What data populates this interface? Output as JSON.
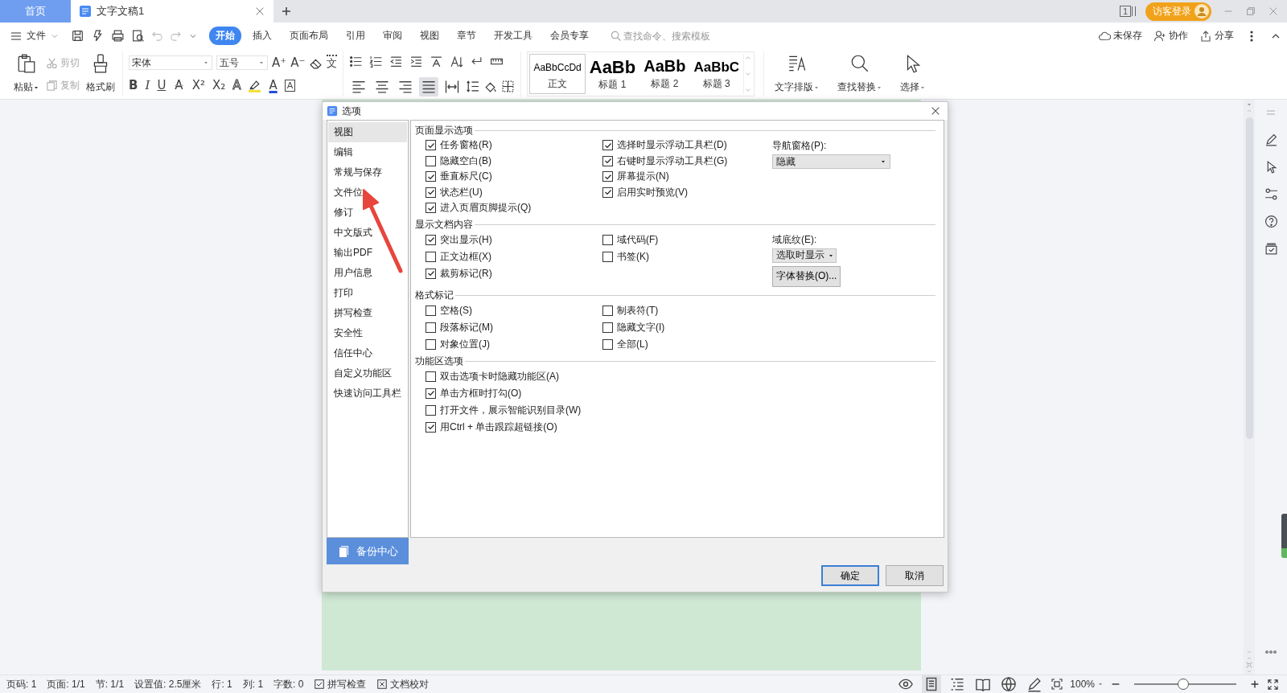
{
  "tabs": [
    {
      "label": "首页",
      "kind": "home",
      "selected": false
    },
    {
      "label": "文字文稿1",
      "kind": "doc",
      "selected": true
    }
  ],
  "title_bar": {
    "window_count": "1",
    "login": "访客登录"
  },
  "menu": {
    "file": "文件",
    "undo": {
      "disabled": true
    },
    "redo": {
      "disabled": true
    },
    "tabs": [
      {
        "label": "开始",
        "selected": true
      },
      {
        "label": "插入",
        "selected": false
      },
      {
        "label": "页面布局",
        "selected": false
      },
      {
        "label": "引用",
        "selected": false
      },
      {
        "label": "审阅",
        "selected": false
      },
      {
        "label": "视图",
        "selected": false
      },
      {
        "label": "章节",
        "selected": false
      },
      {
        "label": "开发工具",
        "selected": false
      },
      {
        "label": "会员专享",
        "selected": false
      }
    ],
    "search": {
      "placeholder": "查找命令、搜索模板"
    },
    "actions": [
      {
        "label": "未保存",
        "kind": "cloud"
      },
      {
        "label": "协作",
        "kind": "collab"
      },
      {
        "label": "分享",
        "kind": "share"
      }
    ]
  },
  "ribbon": {
    "paste": "粘贴",
    "clipboard": [
      {
        "label": "剪切",
        "kind": "cut",
        "disabled": true
      },
      {
        "label": "复制",
        "kind": "copy",
        "disabled": true
      }
    ],
    "format_painter": "格式刷",
    "font": {
      "name": "宋体",
      "size": "五号"
    },
    "font_row1": [
      {
        "glyph": "A⁺",
        "kind": "plain"
      },
      {
        "glyph": "A⁻",
        "kind": "plain"
      },
      {
        "kind": "eraser"
      },
      {
        "glyph": "文",
        "kind": "pinyin"
      }
    ],
    "font_row2": [
      {
        "glyph": "B",
        "kind": "bold"
      },
      {
        "glyph": "I",
        "kind": "italic"
      },
      {
        "glyph": "U",
        "kind": "underline"
      },
      {
        "glyph": "A",
        "kind": "strike"
      },
      {
        "glyph": "X²",
        "kind": "plain"
      },
      {
        "glyph": "X₂",
        "kind": "plain"
      },
      {
        "glyph": "A",
        "kind": "outline"
      },
      {
        "kind": "highlighter"
      },
      {
        "glyph": "A",
        "kind": "color"
      },
      {
        "glyph": "A",
        "kind": "boxed"
      }
    ],
    "alignments": [
      {
        "kind": "left",
        "selected": false
      },
      {
        "kind": "center",
        "selected": false
      },
      {
        "kind": "right",
        "selected": false
      },
      {
        "kind": "justify",
        "selected": true
      },
      {
        "kind": "distributed",
        "selected": false
      }
    ],
    "styles": [
      {
        "sample": "AaBbCcDd",
        "label": "正文",
        "kind": "body",
        "selected": true
      },
      {
        "sample": "AaBb",
        "label": "标题 1",
        "kind": "h1",
        "selected": false
      },
      {
        "sample": "AaBb",
        "label": "标题 2",
        "kind": "h2",
        "selected": false
      },
      {
        "sample": "AaBbC",
        "label": "标题 3",
        "kind": "h3",
        "selected": false
      }
    ],
    "tools": [
      {
        "label": "文字排版",
        "kind": "layout"
      },
      {
        "label": "查找替换",
        "kind": "find"
      },
      {
        "label": "选择",
        "kind": "select"
      }
    ]
  },
  "dialog": {
    "title": "选项",
    "nav": [
      {
        "label": "视图",
        "selected": true
      },
      {
        "label": "编辑",
        "selected": false
      },
      {
        "label": "常规与保存",
        "selected": false
      },
      {
        "label": "文件位",
        "selected": false
      },
      {
        "label": "修订",
        "selected": false
      },
      {
        "label": "中文版式",
        "selected": false
      },
      {
        "label": "输出PDF",
        "selected": false
      },
      {
        "label": "用户信息",
        "selected": false
      },
      {
        "label": "打印",
        "selected": false
      },
      {
        "label": "拼写检查",
        "selected": false
      },
      {
        "label": "安全性",
        "selected": false
      },
      {
        "label": "信任中心",
        "selected": false
      },
      {
        "label": "自定义功能区",
        "selected": false
      },
      {
        "label": "快速访问工具栏",
        "selected": false
      }
    ],
    "backup": "备份中心",
    "sections": [
      {
        "title": "页面显示选项",
        "left": [
          {
            "label": "任务窗格(R)",
            "checked": true
          },
          {
            "label": "隐藏空白(B)",
            "checked": false
          },
          {
            "label": "垂直标尺(C)",
            "checked": true
          },
          {
            "label": "状态栏(U)",
            "checked": true
          },
          {
            "label": "进入页眉页脚提示(Q)",
            "checked": true
          }
        ],
        "right": [
          {
            "label": "选择时显示浮动工具栏(D)",
            "checked": true
          },
          {
            "label": "右键时显示浮动工具栏(G)",
            "checked": true
          },
          {
            "label": "屏幕提示(N)",
            "checked": true
          },
          {
            "label": "启用实时预览(V)",
            "checked": true
          }
        ],
        "side": {
          "kind": "wide_select",
          "label": "导航窗格(P):",
          "value": "隐藏"
        }
      },
      {
        "title": "显示文档内容",
        "left": [
          {
            "label": "突出显示(H)",
            "checked": true
          },
          {
            "label": "正文边框(X)",
            "checked": false
          },
          {
            "label": "裁剪标记(R)",
            "checked": true
          }
        ],
        "right": [
          {
            "label": "域代码(F)",
            "checked": false
          },
          {
            "label": "书签(K)",
            "checked": false
          }
        ],
        "side": {
          "kind": "select_button",
          "label": "域底纹(E):",
          "value": "选取时显示",
          "button": "字体替换(O)..."
        }
      },
      {
        "title": "格式标记",
        "left": [
          {
            "label": "空格(S)",
            "checked": false
          },
          {
            "label": "段落标记(M)",
            "checked": false
          },
          {
            "label": "对象位置(J)",
            "checked": false
          }
        ],
        "right": [
          {
            "label": "制表符(T)",
            "checked": false
          },
          {
            "label": "隐藏文字(I)",
            "checked": false
          },
          {
            "label": "全部(L)",
            "checked": false
          }
        ]
      },
      {
        "title": "功能区选项",
        "left": [
          {
            "label": "双击选项卡时隐藏功能区(A)",
            "checked": false
          },
          {
            "label": "单击方框时打勾(O)",
            "checked": true
          },
          {
            "label": "打开文件，展示智能识别目录(W)",
            "checked": false
          },
          {
            "label": "用Ctrl + 单击跟踪超链接(O)",
            "checked": true
          }
        ]
      }
    ],
    "buttons": [
      {
        "label": "确定",
        "kind": "primary"
      },
      {
        "label": "取消",
        "kind": "secondary"
      }
    ]
  },
  "status_bar": {
    "items": [
      "页码: 1",
      "页面: 1/1",
      "节: 1/1",
      "设置值: 2.5厘米",
      "行: 1",
      "列: 1",
      "字数: 0"
    ],
    "toggles": [
      {
        "label": "拼写检查",
        "kind": "check"
      },
      {
        "label": "文档校对",
        "kind": "cross"
      }
    ],
    "views": [
      {
        "kind": "protect",
        "selected": false
      },
      {
        "kind": "page",
        "selected": true
      },
      {
        "kind": "outline",
        "selected": false
      },
      {
        "kind": "reading",
        "selected": false
      },
      {
        "kind": "web",
        "selected": false
      },
      {
        "kind": "pen",
        "selected": false
      }
    ],
    "zoom": {
      "value": "100%",
      "level": 0.48
    }
  }
}
